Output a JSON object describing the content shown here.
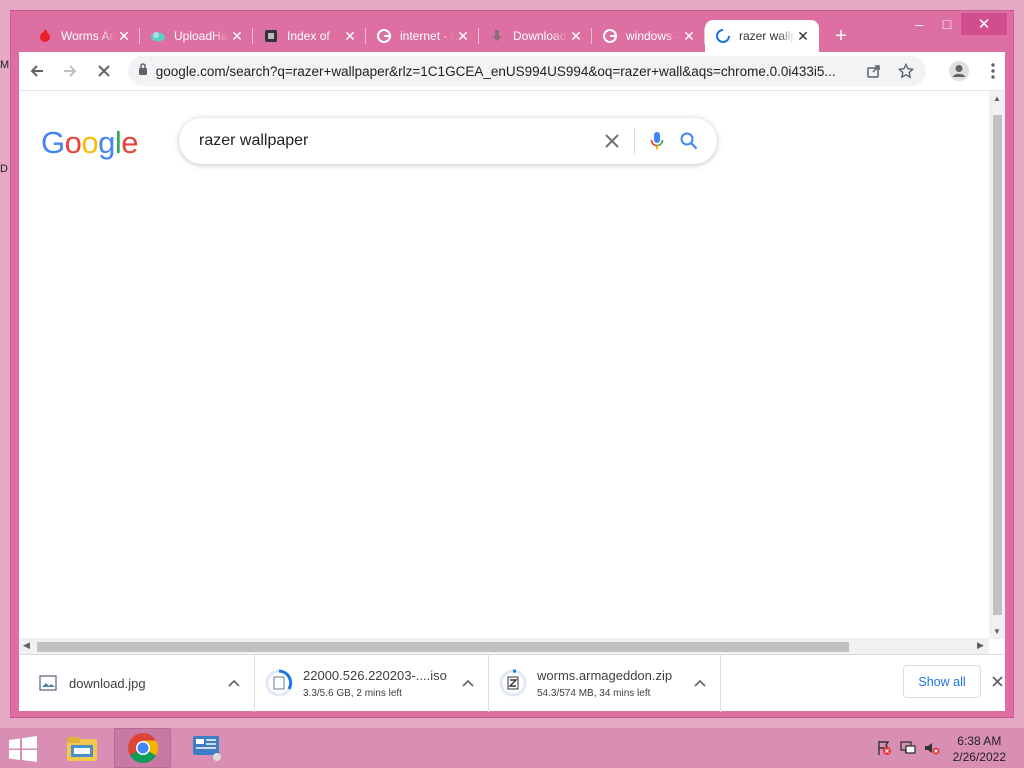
{
  "desktop": {
    "left_labels": [
      "M",
      "D"
    ]
  },
  "window": {
    "controls": {
      "minimize": "–",
      "maximize": "□",
      "close": "✕"
    }
  },
  "tabs": [
    {
      "title": "Worms Armageddon",
      "icon": "worms-favicon-icon",
      "close": "✕"
    },
    {
      "title": "UploadHaven",
      "icon": "uploadhaven-favicon-icon",
      "close": "✕"
    },
    {
      "title": "Index of",
      "icon": "index-favicon-icon",
      "close": "✕"
    },
    {
      "title": "internet - Google Search",
      "icon": "google-g-icon",
      "close": "✕"
    },
    {
      "title": "Downloads",
      "icon": "download-favicon-icon",
      "close": "✕"
    },
    {
      "title": "windows - Google Search",
      "icon": "google-g-icon",
      "close": "✕"
    },
    {
      "title": "razer wallpaper",
      "icon": "loading-spinner-icon",
      "close": "✕",
      "active": true
    }
  ],
  "new_tab_label": "+",
  "toolbar": {
    "url": "google.com/search?q=razer+wallpaper&rlz=1C1GCEA_enUS994US994&oq=razer+wall&aqs=chrome.0.0i433i5..."
  },
  "search": {
    "logo_letters": [
      "G",
      "o",
      "o",
      "g",
      "l",
      "e"
    ],
    "query": "razer wallpaper"
  },
  "downloads": {
    "items": [
      {
        "name": "download.jpg",
        "status": "",
        "icon": "image-file-icon"
      },
      {
        "name": "22000.526.220203-....iso",
        "status": "3.3/5.6 GB, 2 mins left",
        "icon": "disc-image-file-icon"
      },
      {
        "name": "worms.armageddon.zip",
        "status": "54.3/574 MB, 34 mins left",
        "icon": "zip-file-icon"
      }
    ],
    "show_all": "Show all"
  },
  "taskbar": {
    "time": "6:38 AM",
    "date": "2/26/2022"
  },
  "colors": {
    "chrome_frame": "#dd6fa3",
    "taskbar": "#d98eb3",
    "accent_link": "#1a73e8"
  }
}
